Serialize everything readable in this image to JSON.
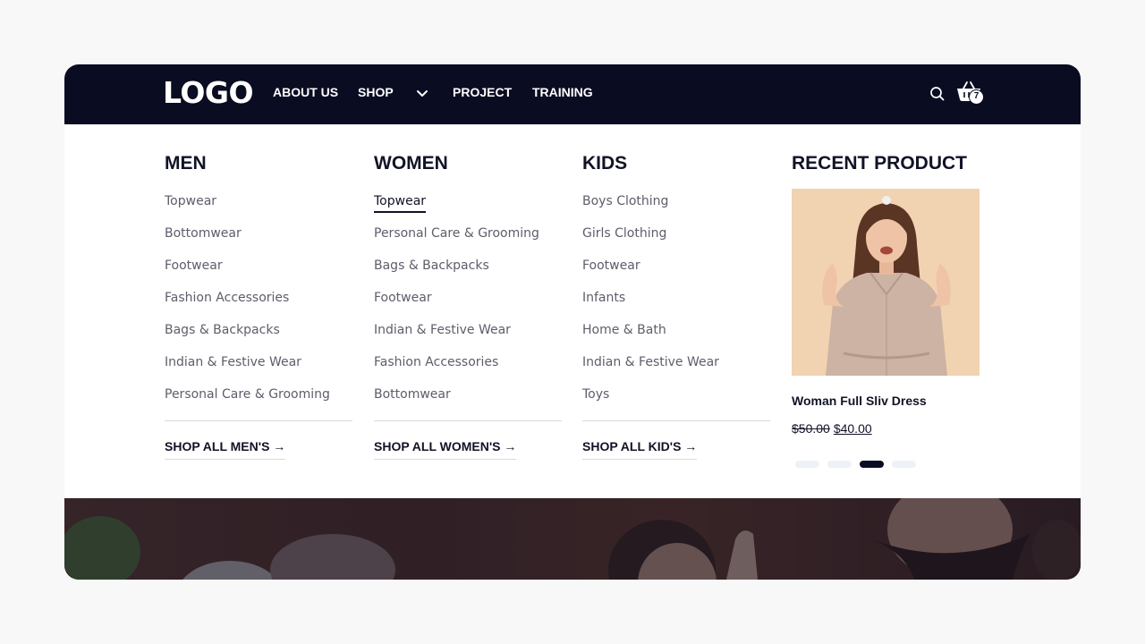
{
  "header": {
    "logo": "LOGO",
    "nav": [
      {
        "label": "ABOUT US"
      },
      {
        "label": "SHOP"
      },
      {
        "label": "PROJECT"
      },
      {
        "label": "TRAINING"
      }
    ],
    "cart_count": "7",
    "icons": {
      "search": "search-icon",
      "cart": "basket-icon",
      "dropdown": "chevron-down-icon"
    }
  },
  "mega_menu": {
    "columns": [
      {
        "title": "MEN",
        "items": [
          "Topwear",
          "Bottomwear",
          "Footwear",
          "Fashion Accessories",
          "Bags & Backpacks",
          "Indian & Festive Wear",
          "Personal Care & Grooming"
        ],
        "shop_all": "SHOP ALL MEN'S →"
      },
      {
        "title": "WOMEN",
        "items": [
          "Topwear",
          "Personal Care & Grooming",
          "Bags & Backpacks",
          "Footwear",
          "Indian & Festive Wear",
          "Fashion Accessories",
          "Bottomwear"
        ],
        "active_item": "Topwear",
        "shop_all": "SHOP ALL WOMEN'S →"
      },
      {
        "title": "KIDS",
        "items": [
          "Boys Clothing",
          "Girls Clothing",
          "Footwear",
          "Infants",
          "Home & Bath",
          "Indian & Festive Wear",
          "Toys"
        ],
        "shop_all": "SHOP ALL KID'S →"
      }
    ],
    "recent": {
      "title": "RECENT PRODUCT",
      "product_name": "Woman Full Sliv Dress",
      "price_old": "$50.00",
      "price_new": "$40.00",
      "carousel_total": 4,
      "carousel_active": 3
    }
  },
  "colors": {
    "navbar": "#0a0c22",
    "text_dark": "#111326",
    "text_muted": "#5c5e6a",
    "divider": "#d7d9df",
    "page_bg": "#f8f8f8",
    "product_bg": "#f1d3b1"
  }
}
